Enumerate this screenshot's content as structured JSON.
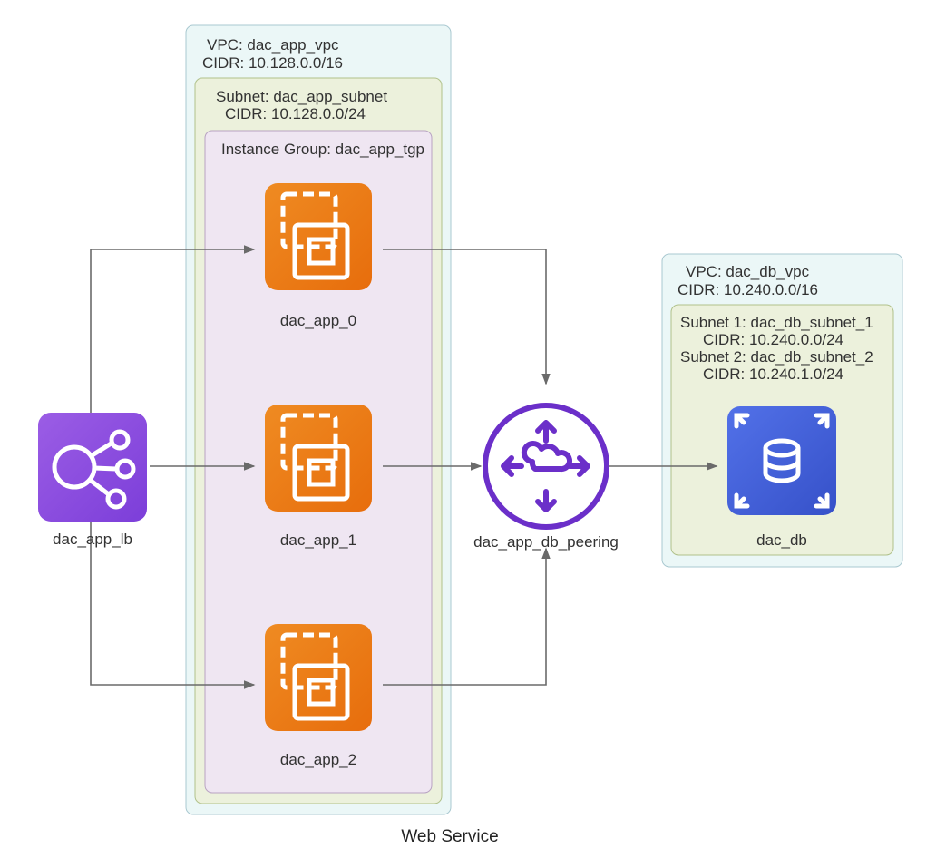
{
  "diagram_title": "Web Service",
  "vpc_app": {
    "line1": "VPC: dac_app_vpc",
    "line2": "CIDR: 10.128.0.0/16"
  },
  "subnet_app": {
    "line1": "Subnet: dac_app_subnet",
    "line2": "CIDR: 10.128.0.0/24"
  },
  "ig_app": {
    "line1": "Instance Group: dac_app_tgp"
  },
  "vpc_db": {
    "line1": "VPC: dac_db_vpc",
    "line2": "CIDR: 10.240.0.0/16"
  },
  "subnet_db": {
    "line1": "Subnet 1: dac_db_subnet_1",
    "line2": "CIDR: 10.240.0.0/24",
    "line3": "Subnet 2: dac_db_subnet_2",
    "line4": "CIDR: 10.240.1.0/24"
  },
  "nodes": {
    "lb": "dac_app_lb",
    "app0": "dac_app_0",
    "app1": "dac_app_1",
    "app2": "dac_app_2",
    "peering": "dac_app_db_peering",
    "db": "dac_db"
  },
  "chart_data": {
    "type": "architecture-graph",
    "clusters": [
      {
        "id": "web_service",
        "label": "Web Service",
        "clusters": [
          {
            "id": "dac_app_vpc",
            "label": "VPC: dac_app_vpc",
            "cidr": "10.128.0.0/16",
            "clusters": [
              {
                "id": "dac_app_subnet",
                "label": "Subnet: dac_app_subnet",
                "cidr": "10.128.0.0/24",
                "clusters": [
                  {
                    "id": "dac_app_tgp",
                    "label": "Instance Group: dac_app_tgp",
                    "nodes": [
                      "dac_app_0",
                      "dac_app_1",
                      "dac_app_2"
                    ]
                  }
                ]
              }
            ]
          },
          {
            "id": "dac_db_vpc",
            "label": "VPC: dac_db_vpc",
            "cidr": "10.240.0.0/16",
            "clusters": [
              {
                "id": "dac_db_subnets",
                "subnets": [
                  {
                    "label": "Subnet 1: dac_db_subnet_1",
                    "cidr": "10.240.0.0/24"
                  },
                  {
                    "label": "Subnet 2: dac_db_subnet_2",
                    "cidr": "10.240.1.0/24"
                  }
                ],
                "nodes": [
                  "dac_db"
                ]
              }
            ]
          }
        ],
        "nodes": [
          "dac_app_lb",
          "dac_app_db_peering"
        ]
      }
    ],
    "nodes": [
      {
        "id": "dac_app_lb",
        "type": "ELB"
      },
      {
        "id": "dac_app_0",
        "type": "EC2"
      },
      {
        "id": "dac_app_1",
        "type": "EC2"
      },
      {
        "id": "dac_app_2",
        "type": "EC2"
      },
      {
        "id": "dac_app_db_peering",
        "type": "VPCPeering"
      },
      {
        "id": "dac_db",
        "type": "RDS"
      }
    ],
    "edges": [
      [
        "dac_app_lb",
        "dac_app_0"
      ],
      [
        "dac_app_lb",
        "dac_app_1"
      ],
      [
        "dac_app_lb",
        "dac_app_2"
      ],
      [
        "dac_app_0",
        "dac_app_db_peering"
      ],
      [
        "dac_app_1",
        "dac_app_db_peering"
      ],
      [
        "dac_app_2",
        "dac_app_db_peering"
      ],
      [
        "dac_app_db_peering",
        "dac_db"
      ]
    ]
  }
}
